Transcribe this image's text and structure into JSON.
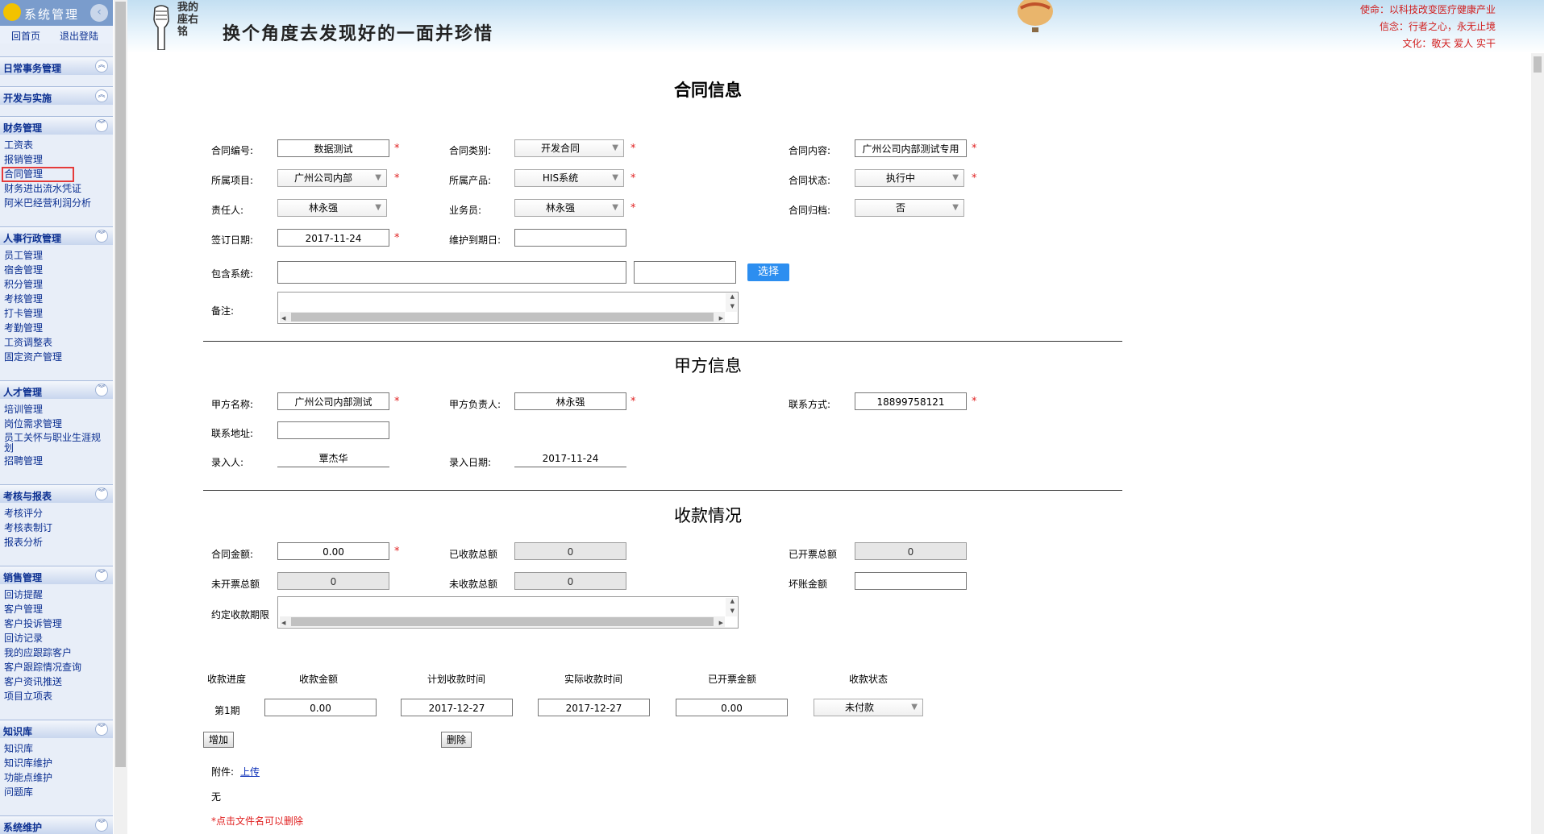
{
  "sidebar": {
    "logo_text": "系统管理",
    "top_links": {
      "home": "回首页",
      "logout": "退出登陆"
    },
    "sections": [
      {
        "title": "日常事务管理",
        "items": []
      },
      {
        "title": "开发与实施",
        "items": []
      },
      {
        "title": "财务管理",
        "items": [
          "工资表",
          "报销管理",
          "合同管理",
          "财务进出流水凭证",
          "阿米巴经营利润分析"
        ]
      },
      {
        "title": "人事行政管理",
        "items": [
          "员工管理",
          "宿舍管理",
          "积分管理",
          "考核管理",
          "打卡管理",
          "考勤管理",
          "工资调整表",
          "固定资产管理"
        ]
      },
      {
        "title": "人才管理",
        "items": [
          "培训管理",
          "岗位需求管理",
          "员工关怀与职业生涯规",
          "划",
          "招聘管理"
        ]
      },
      {
        "title": "考核与报表",
        "items": [
          "考核评分",
          "考核表制订",
          "报表分析"
        ]
      },
      {
        "title": "销售管理",
        "items": [
          "回访提醒",
          "客户管理",
          "客户投诉管理",
          "回访记录",
          "我的应跟踪客户",
          "客户跟踪情况查询",
          "客户资讯推送",
          "项目立项表"
        ]
      },
      {
        "title": "知识库",
        "items": [
          "知识库",
          "知识库维护",
          "功能点维护",
          "问题库"
        ]
      },
      {
        "title": "系统维护",
        "items": []
      }
    ],
    "selected_item": "合同管理"
  },
  "header": {
    "motto_small": "我的座右铭",
    "motto": "换个角度去发现好的一面并珍惜",
    "slogans": [
      "使命：以科技改变医疗健康产业",
      "信念：行者之心，永无止境",
      "文化：敬天 爱人 实干"
    ]
  },
  "contract_info": {
    "title": "合同信息",
    "contract_no": {
      "label": "合同编号:",
      "value": "数据测试"
    },
    "contract_type": {
      "label": "合同类别:",
      "value": "开发合同"
    },
    "contract_content": {
      "label": "合同内容:",
      "value": "广州公司内部测试专用"
    },
    "project": {
      "label": "所属项目:",
      "value": "广州公司内部"
    },
    "product": {
      "label": "所属产品:",
      "value": "HIS系统"
    },
    "status": {
      "label": "合同状态:",
      "value": "执行中"
    },
    "owner": {
      "label": "责任人:",
      "value": "林永强"
    },
    "salesman": {
      "label": "业务员:",
      "value": "林永强"
    },
    "archived": {
      "label": "合同归档:",
      "value": "否"
    },
    "sign_date": {
      "label": "签订日期:",
      "value": "2017-11-24"
    },
    "maintain_date": {
      "label": "维护到期日:",
      "value": ""
    },
    "systems": {
      "label": "包含系统:",
      "value": "",
      "value2": ""
    },
    "choose_button": "选择",
    "remark": {
      "label": "备注:"
    }
  },
  "party_a": {
    "title": "甲方信息",
    "name": {
      "label": "甲方名称:",
      "value": "广州公司内部测试"
    },
    "contact_person": {
      "label": "甲方负责人:",
      "value": "林永强"
    },
    "phone": {
      "label": "联系方式:",
      "value": "18899758121"
    },
    "address": {
      "label": "联系地址:",
      "value": ""
    },
    "entered_by": {
      "label": "录入人:",
      "value": "覃杰华"
    },
    "entered_date": {
      "label": "录入日期:",
      "value": "2017-11-24"
    }
  },
  "payment": {
    "title": "收款情况",
    "contract_amount": {
      "label": "合同金额:",
      "value": "0.00"
    },
    "received_total": {
      "label": "已收款总额",
      "value": "0"
    },
    "invoiced_total": {
      "label": "已开票总额",
      "value": "0"
    },
    "uninvoiced_total": {
      "label": "未开票总额",
      "value": "0"
    },
    "unreceived_total": {
      "label": "未收款总额",
      "value": "0"
    },
    "bad_debt": {
      "label": "坏账金额",
      "value": ""
    },
    "agreed_period": {
      "label": "约定收款期限"
    }
  },
  "schedule": {
    "headers": [
      "收款进度",
      "收款金额",
      "计划收款时间",
      "实际收款时间",
      "已开票金额",
      "收款状态"
    ],
    "rows": [
      {
        "stage": "第1期",
        "amount": "0.00",
        "planned": "2017-12-27",
        "actual": "2017-12-27",
        "invoiced": "0.00",
        "status": "未付款"
      }
    ],
    "add_button": "增加",
    "delete_button": "删除"
  },
  "attachment": {
    "label": "附件:",
    "upload_link": "上传",
    "none_text": "无",
    "hint": "*点击文件名可以删除"
  },
  "colors": {
    "accent": "#2c8ef0",
    "required": "#e02020",
    "link": "#0b2f91"
  }
}
